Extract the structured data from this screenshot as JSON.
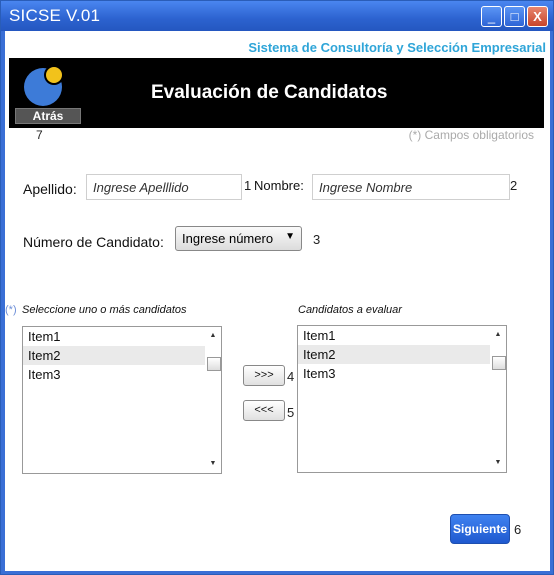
{
  "window": {
    "title": "SICSE V.01",
    "minimize": "_",
    "maximize": "□",
    "close": "X"
  },
  "app": {
    "subtitle": "Sistema de Consultoría y Selección Empresarial"
  },
  "header": {
    "title": "Evaluación de Candidatos",
    "back_label": "Atrás"
  },
  "required_note": "(*) Campos obligatorios",
  "form": {
    "apellido_label": "Apellido:",
    "apellido_placeholder": "Ingrese Apelllido",
    "nombre_label": "Nombre:",
    "nombre_placeholder": "Ingrese Nombre",
    "numero_label": "Número de Candidato:",
    "numero_value": "Ingrese número"
  },
  "lists": {
    "required_mark": "(*)",
    "left_label": "Seleccione uno o más candidatos",
    "right_label": "Candidatos a evaluar",
    "left_items": [
      "Item1",
      "Item2",
      "Item3"
    ],
    "right_items": [
      "Item1",
      "Item2",
      "Item3"
    ],
    "add_label": ">>>",
    "remove_label": "<<<"
  },
  "next_label": "Siguiente",
  "annotations": {
    "n1": "1",
    "n2": "2",
    "n3": "3",
    "n4": "4",
    "n5": "5",
    "n6": "6",
    "n7": "7"
  },
  "colors": {
    "accent": "#2fa5d8",
    "titlebar": "#2c62cf",
    "primary_button": "#2a67db"
  },
  "icons": {
    "logo": "moon-sun-logo-icon",
    "dropdown": "chevron-down-icon",
    "scroll_up": "scroll-up-icon",
    "scroll_down": "scroll-down-icon"
  }
}
